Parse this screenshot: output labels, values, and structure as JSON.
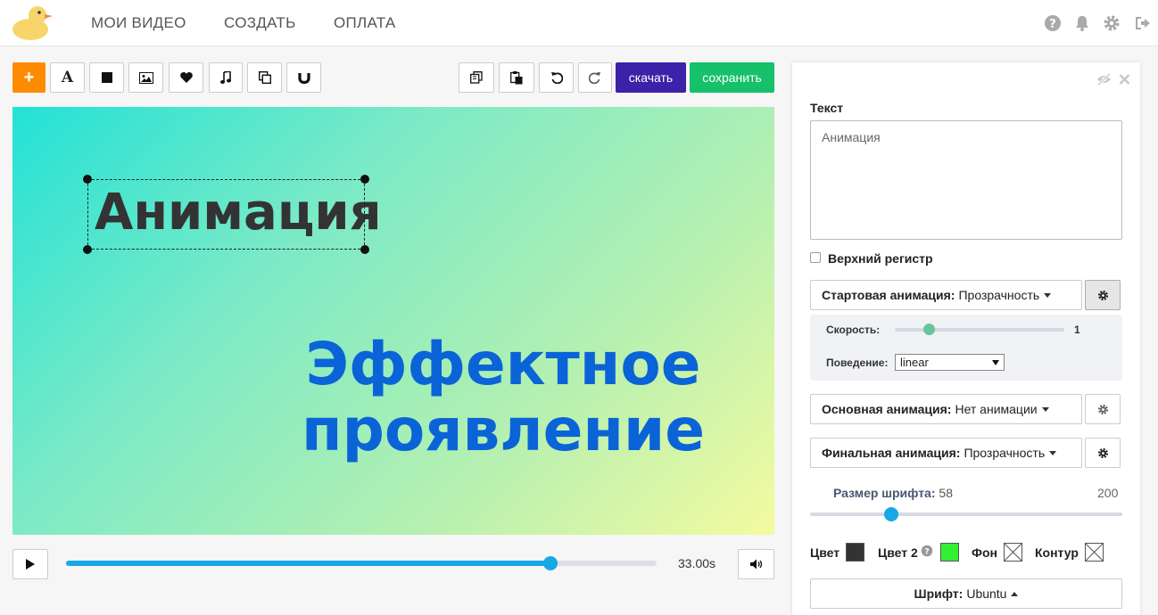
{
  "nav": {
    "items": [
      "МОИ ВИДЕО",
      "СОЗДАТЬ",
      "ОПЛАТА"
    ]
  },
  "toolbar": {
    "add_label": "+",
    "text_label": "A",
    "download_label": "скачать",
    "save_label": "сохранить"
  },
  "canvas": {
    "selected_text": "Анимация",
    "effect_line1": "Эффектное",
    "effect_line2": "проявление",
    "background_colors": [
      "#22e2d6",
      "#f4fba0"
    ],
    "effect_color": "#0b63d8"
  },
  "player": {
    "time": "33.00s",
    "progress": 0.82
  },
  "panel": {
    "text_label": "Текст",
    "text_value": "Анимация",
    "uppercase_label": "Верхний регистр",
    "uppercase_checked": false,
    "start_anim_label": "Стартовая анимация:",
    "start_anim_value": "Прозрачность",
    "speed_label": "Скорость:",
    "speed_value": "1",
    "speed_fraction": 0.2,
    "behavior_label": "Поведение:",
    "behavior_value": "linear",
    "main_anim_label": "Основная анимация:",
    "main_anim_value": "Нет анимации",
    "final_anim_label": "Финальная анимация:",
    "final_anim_value": "Прозрачность",
    "font_size_label": "Размер шрифта:",
    "font_size_value": "58",
    "font_size_max": "200",
    "font_size_fraction": 0.26,
    "color_label": "Цвет",
    "color_value": "#333333",
    "color2_label": "Цвет 2",
    "color2_value": "#33ee33",
    "bg_label": "Фон",
    "outline_label": "Контур",
    "font_label": "Шрифт:",
    "font_value": "Ubuntu"
  }
}
